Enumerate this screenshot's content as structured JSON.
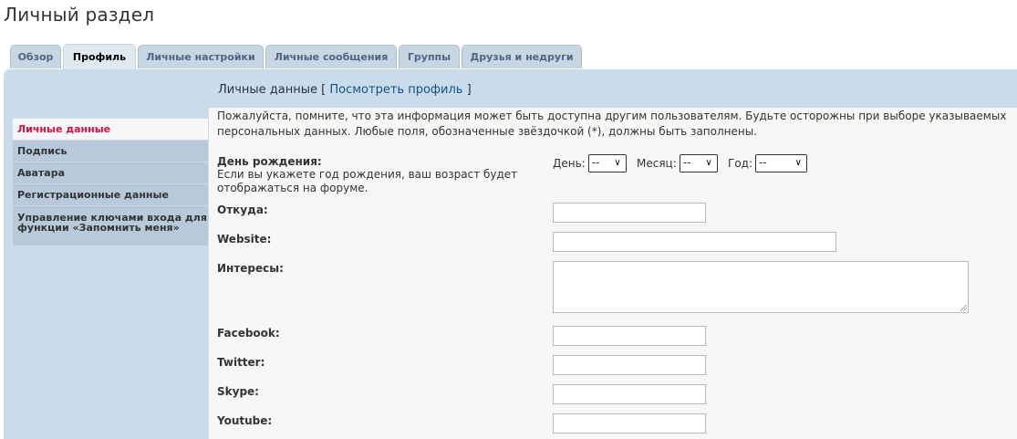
{
  "page": {
    "title": "Личный раздел"
  },
  "tabs": [
    {
      "label": "Обзор"
    },
    {
      "label": "Профиль"
    },
    {
      "label": "Личные настройки"
    },
    {
      "label": "Личные сообщения"
    },
    {
      "label": "Группы"
    },
    {
      "label": "Друзья и недруги"
    }
  ],
  "active_tab": "Профиль",
  "sidebar": {
    "items": [
      {
        "label": "Личные данные"
      },
      {
        "label": "Подпись"
      },
      {
        "label": "Аватара"
      },
      {
        "label": "Регистрационные данные"
      },
      {
        "label": "Управление ключами входа для функции «Запомнить меня»"
      }
    ],
    "active": "Личные данные"
  },
  "content": {
    "heading": "Личные данные",
    "bracket_open": "[",
    "view_profile_link": "Посмотреть профиль",
    "bracket_close": "]",
    "notice": "Пожалуйста, помните, что эта информация может быть доступна другим пользователям. Будьте осторожны при выборе указываемых персональных данных. Любые поля, обозначенные звёздочкой (*), должны быть заполнены."
  },
  "form": {
    "birthday": {
      "label": "День рождения:",
      "description": "Если вы укажете год рождения, ваш возраст будет отображаться на форуме.",
      "day_label": "День:",
      "day_value": "--",
      "month_label": "Месяц:",
      "month_value": "--",
      "year_label": "Год:",
      "year_value": "--"
    },
    "location": {
      "label": "Откуда:",
      "value": ""
    },
    "website": {
      "label": "Website:",
      "value": ""
    },
    "interests": {
      "label": "Интересы:",
      "value": ""
    },
    "facebook": {
      "label": "Facebook:",
      "value": ""
    },
    "twitter": {
      "label": "Twitter:",
      "value": ""
    },
    "skype": {
      "label": "Skype:",
      "value": ""
    },
    "youtube": {
      "label": "Youtube:",
      "value": ""
    }
  },
  "colors": {
    "tab_bg": "#c6d6e3",
    "tab_text": "#536482",
    "panel_bg": "#cadceb",
    "content_bg": "#f7f7f7",
    "menu_item_bg": "#b8cad9",
    "active_menu_text": "#d31141",
    "link": "#105289"
  },
  "icons": {
    "select_arrow": "chevron-down-icon",
    "textarea_resize": "resize-grip-icon"
  }
}
